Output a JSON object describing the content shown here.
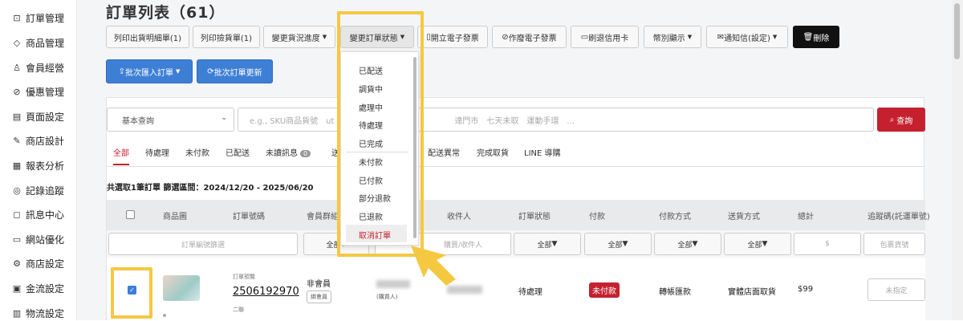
{
  "sidebar": {
    "items": [
      {
        "label": "訂單管理",
        "icon": "cart-icon"
      },
      {
        "label": "商品管理",
        "icon": "tag-icon"
      },
      {
        "label": "會員經營",
        "icon": "user-icon"
      },
      {
        "label": "優惠管理",
        "icon": "discount-icon"
      },
      {
        "label": "頁面設定",
        "icon": "page-icon"
      },
      {
        "label": "商店設計",
        "icon": "brush-icon"
      },
      {
        "label": "報表分析",
        "icon": "chart-icon"
      },
      {
        "label": "記錄追蹤",
        "icon": "target-icon"
      },
      {
        "label": "訊息中心",
        "icon": "chat-icon"
      },
      {
        "label": "網站優化",
        "icon": "monitor-icon"
      },
      {
        "label": "商店設定",
        "icon": "gear-icon"
      },
      {
        "label": "金流設定",
        "icon": "money-icon"
      },
      {
        "label": "物流設定",
        "icon": "truck-icon"
      }
    ]
  },
  "page": {
    "title": "訂單列表（61）"
  },
  "toolbar": {
    "print_detail": "列印出貨明細單(1)",
    "print_pick": "列印撿貨單(1)",
    "change_shipping": "變更貨況進度",
    "change_status": "變更訂單狀態",
    "issue_invoice": "開立電子發票",
    "void_invoice": "作廢電子發票",
    "refund_card": "刷退信用卡",
    "currency": "幣別顯示",
    "notify": "通知信(設定)",
    "delete": "刪除",
    "batch_import": "批次匯入訂單",
    "batch_update": "批次訂單更新"
  },
  "search": {
    "mode": "基本查詢",
    "placeholder_left": "e.g., SKU商品貨號　ut",
    "placeholder_right": "達門市　七天未取　運動手環　...",
    "button": "查詢"
  },
  "tabs": [
    {
      "label": "全部"
    },
    {
      "label": "待處理"
    },
    {
      "label": "未付款"
    },
    {
      "label": "已配送"
    },
    {
      "label": "未讀訊息",
      "badge": "0"
    },
    {
      "label": "送"
    },
    {
      "label": "配送異常"
    },
    {
      "label": "完成取貨"
    },
    {
      "label": "LINE 導購"
    }
  ],
  "summary": "共選取1筆訂單 篩選區間：2024/12/20 - 2025/06/20",
  "table": {
    "headers": [
      "商品圖",
      "訂單號碼",
      "會員群組",
      "收件人",
      "訂單狀態",
      "付款",
      "付款方式",
      "送貨方式",
      "總計",
      "追蹤碼(託運單號)"
    ],
    "filters": {
      "order_no_placeholder": "訂單編號篩選",
      "all": "全部",
      "buyer_placeholder": "購買/收件人",
      "amount_placeholder": "$",
      "package_placeholder": "包裹貨號"
    },
    "row": {
      "order_tag": "訂單預覽",
      "order_no": "2506192970",
      "order_sub": "二聯",
      "member": "非會員",
      "member_btn": "綁會員",
      "buyer_note": "(購買人)",
      "status": "待處理",
      "payment": "未付款",
      "method": "轉帳匯款",
      "shipping": "實體店面取貨",
      "total": "$99",
      "tracking": "未指定"
    }
  },
  "dropdown": {
    "items": [
      "已配送",
      "調貨中",
      "處理中",
      "待處理",
      "已完成",
      "未付款",
      "已付款",
      "部分退款",
      "已退款",
      "取消訂單"
    ]
  },
  "colors": {
    "accent": "#c5202e",
    "primary": "#3e7fd6",
    "highlight": "#f5c842"
  }
}
